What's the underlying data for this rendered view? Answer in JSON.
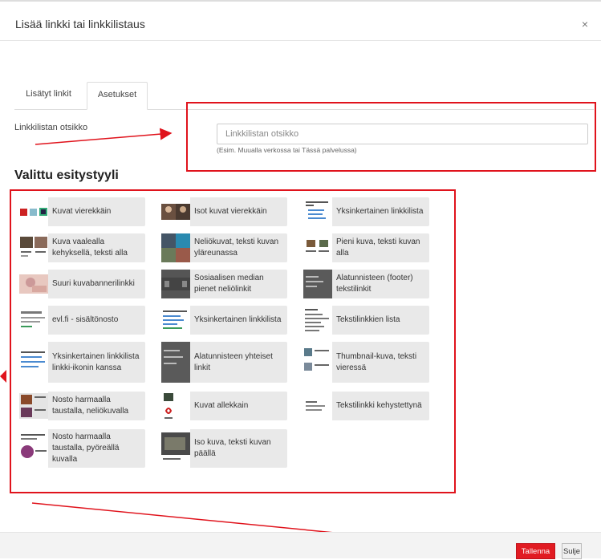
{
  "dialog": {
    "title": "Lisää linkki tai linkkilistaus",
    "close_symbol": "×"
  },
  "tabs": [
    {
      "label": "Lisätyt linkit"
    },
    {
      "label": "Asetukset"
    }
  ],
  "form": {
    "label": "Linkkilistan otsikko",
    "placeholder": "Linkkilistan otsikko",
    "value": "",
    "hint": "(Esim. Muualla verkossa tai Tässä palvelussa)"
  },
  "styles_section": {
    "title": "Valittu esitystyyli",
    "items": [
      {
        "label": "Kuvat vierekkäin"
      },
      {
        "label": "Isot kuvat vierekkäin"
      },
      {
        "label": "Yksinkertainen linkkilista"
      },
      {
        "label": "Kuva vaalealla kehyksellä, teksti alla"
      },
      {
        "label": "Neliökuvat, teksti kuvan yläreunassa"
      },
      {
        "label": "Pieni kuva, teksti kuvan alla"
      },
      {
        "label": "Suuri kuvabannerilinkki"
      },
      {
        "label": "Sosiaalisen median pienet neliölinkit"
      },
      {
        "label": "Alatunnisteen (footer) tekstilinkit"
      },
      {
        "label": "evl.fi - sisältönosto"
      },
      {
        "label": "Yksinkertainen linkkilista"
      },
      {
        "label": "Tekstilinkkien lista"
      },
      {
        "label": "Yksinkertainen linkkilista linkki-ikonin kanssa"
      },
      {
        "label": "Alatunnisteen yhteiset linkit"
      },
      {
        "label": "Thumbnail-kuva, teksti vieressä"
      },
      {
        "label": "Nosto harmaalla taustalla, neliökuvalla"
      },
      {
        "label": "Kuvat allekkain"
      },
      {
        "label": "Tekstilinkki kehystettynä"
      },
      {
        "label": "Nosto harmaalla taustalla, pyöreällä kuvalla"
      },
      {
        "label": "Iso kuva, teksti kuvan päällä"
      }
    ]
  },
  "footer": {
    "save_label": "Tallenna",
    "close_label": "Sulje"
  },
  "colors": {
    "accent_red": "#e0131c",
    "card_bg": "#e9e9e9"
  }
}
